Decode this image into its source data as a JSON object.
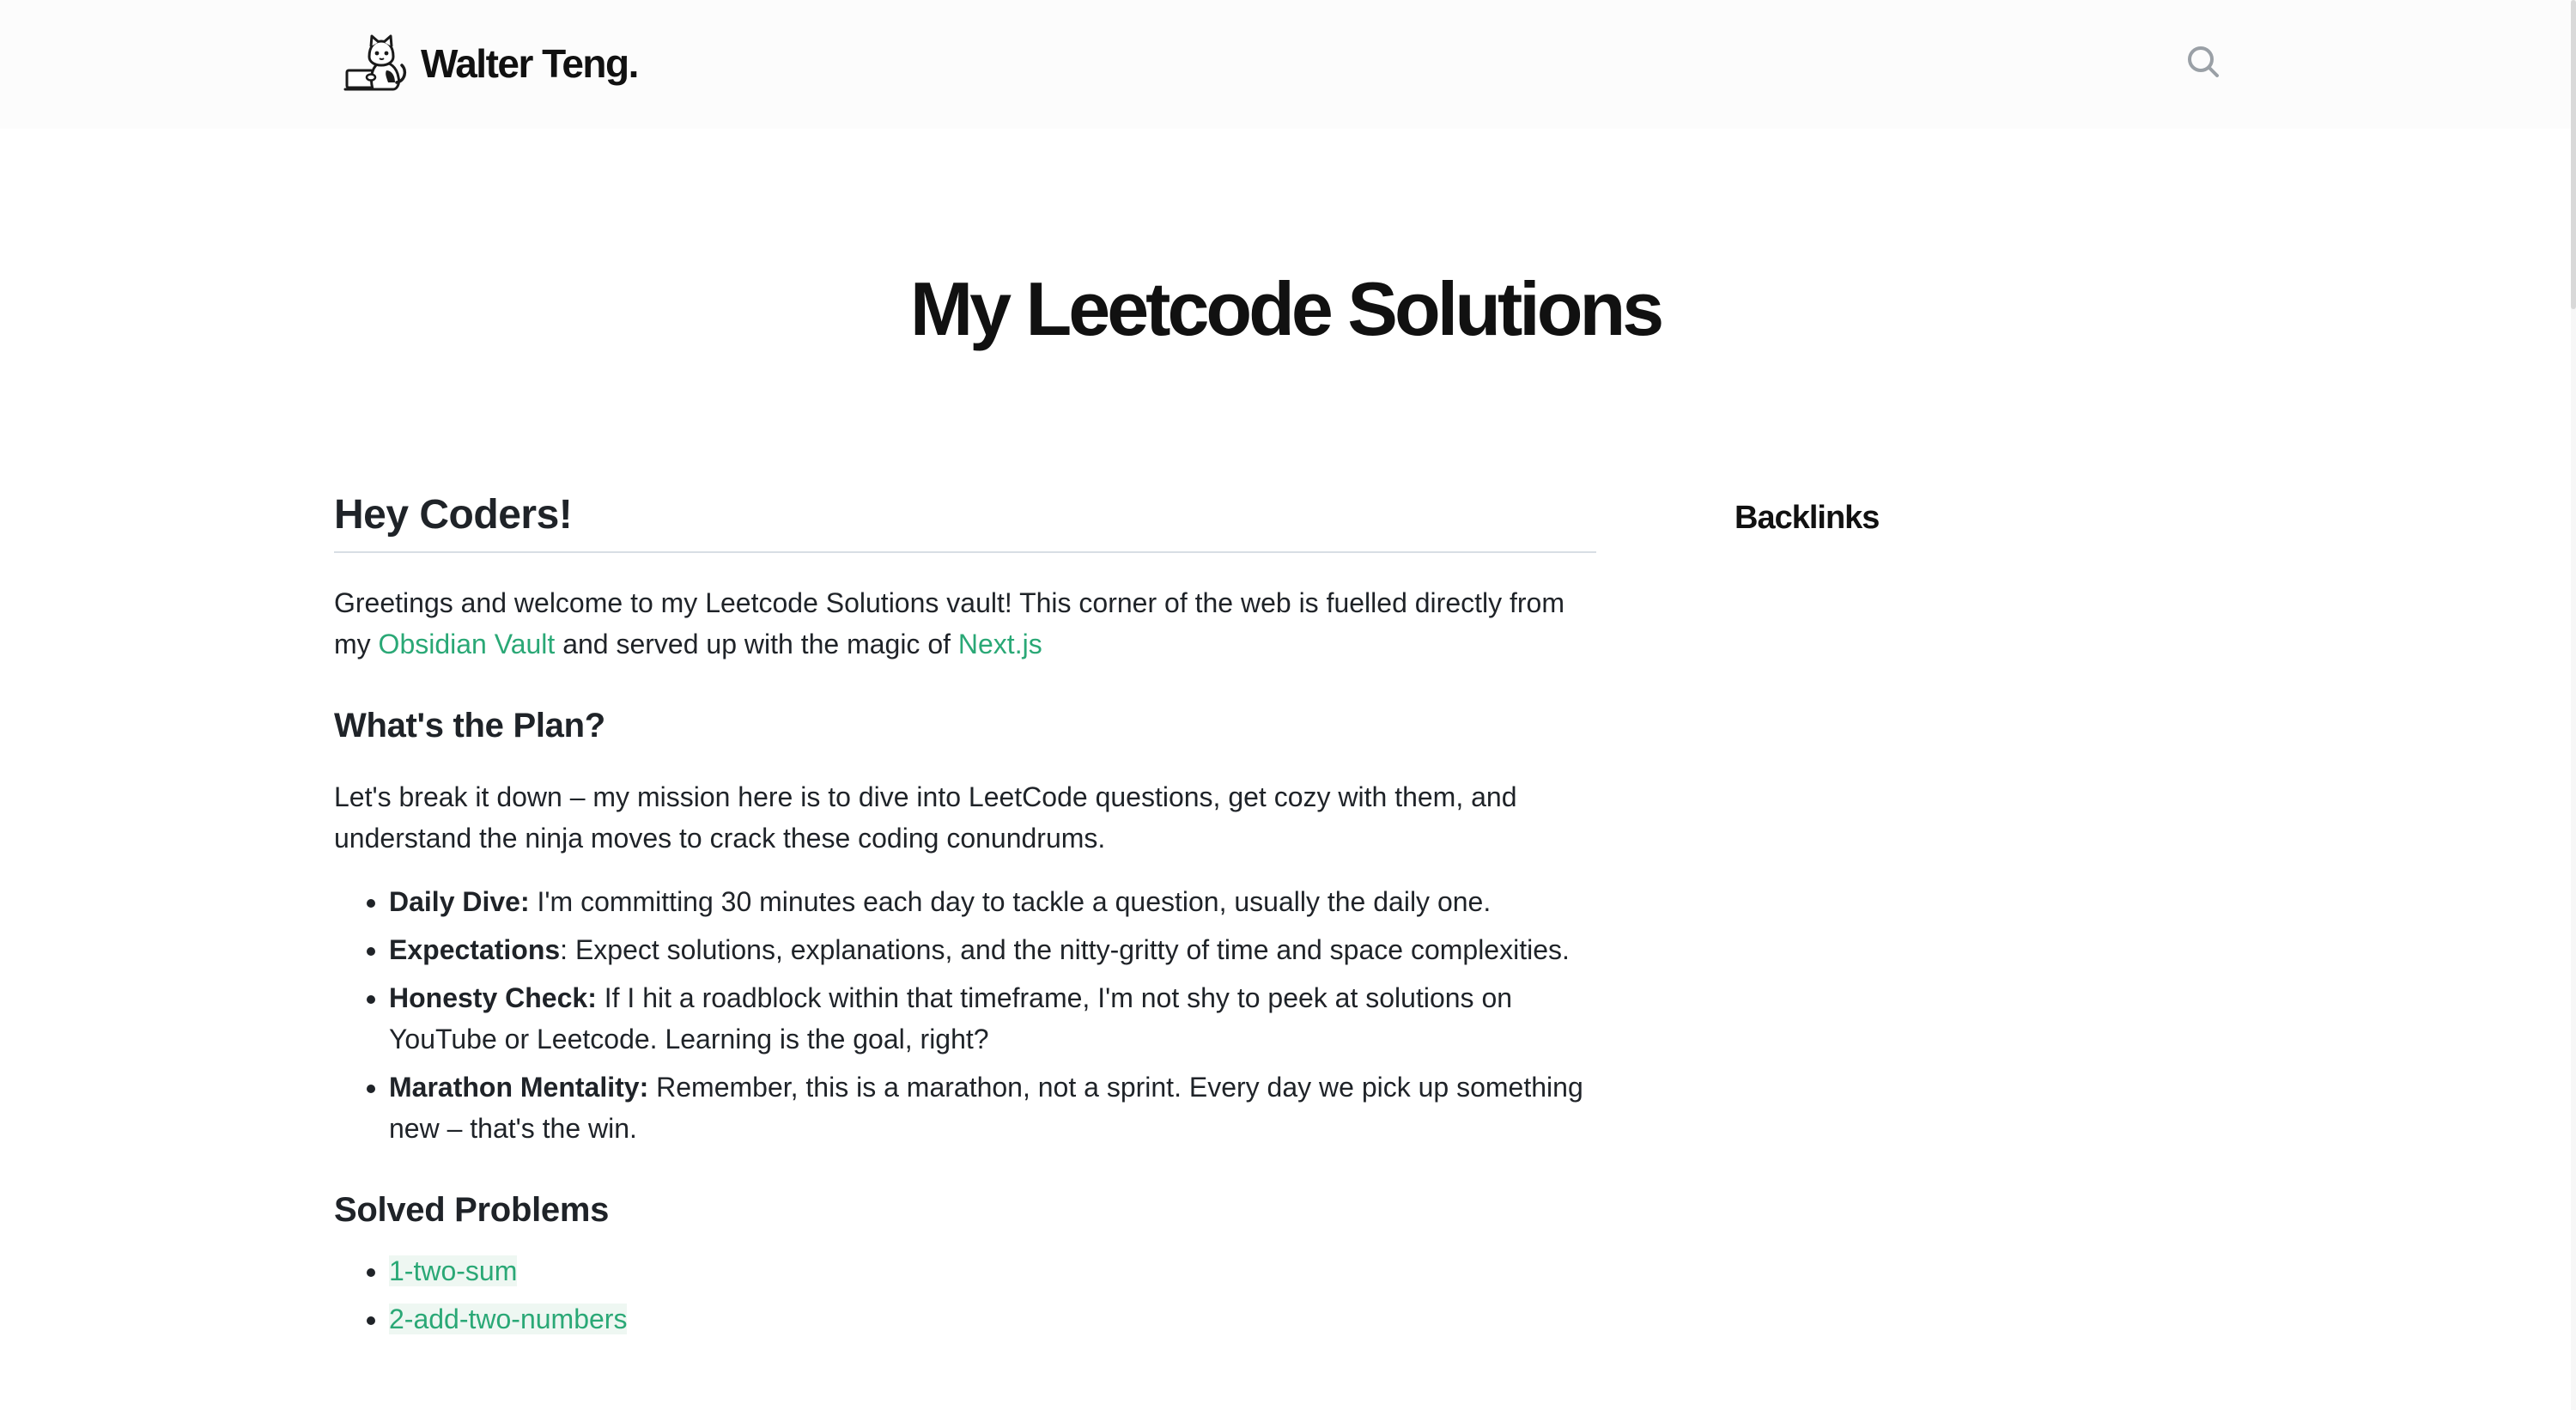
{
  "header": {
    "brand_name": "Walter Teng.",
    "logo_icon": "cat-with-laptop-logo",
    "search_icon": "search-icon"
  },
  "page_title": "My Leetcode Solutions",
  "intro": {
    "heading": "Hey Coders!",
    "text_before": "Greetings and welcome to my Leetcode Solutions vault! This corner of the web is fuelled directly from my ",
    "link1": "Obsidian Vault",
    "text_middle": " and served up with the magic of ",
    "link2": "Next.js"
  },
  "plan": {
    "heading": "What's the Plan?",
    "text": "Let's break it down – my mission here is to dive into LeetCode questions, get cozy with them, and understand the ninja moves to crack these coding conundrums.",
    "items": [
      {
        "label": "Daily Dive:",
        "text": " I'm committing 30 minutes each day to tackle a question, usually the daily one."
      },
      {
        "label": "Expectations",
        "text": ": Expect solutions, explanations, and the nitty-gritty of time and space complexities."
      },
      {
        "label": "Honesty Check:",
        "text": " If I hit a roadblock within that timeframe, I'm not shy to peek at solutions on YouTube or Leetcode. Learning is the goal, right?"
      },
      {
        "label": "Marathon Mentality:",
        "text": " Remember, this is a marathon, not a sprint. Every day we pick up something new – that's the win."
      }
    ]
  },
  "solved": {
    "heading": "Solved Problems",
    "items": [
      "1-two-sum",
      "2-add-two-numbers"
    ]
  },
  "sidebar": {
    "backlinks_title": "Backlinks"
  },
  "colors": {
    "link": "#2aa876",
    "text": "#1f2328",
    "header_bg": "#fcfcfc"
  }
}
